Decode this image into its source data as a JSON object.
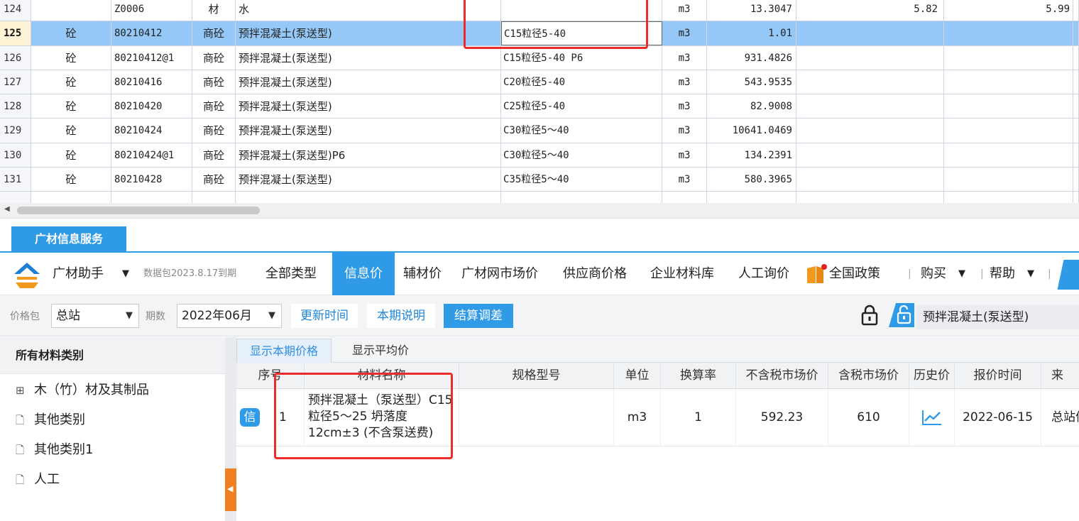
{
  "top_table": {
    "rows": [
      {
        "no": "124",
        "type": "",
        "code": "Z0006",
        "cat": "材",
        "name": "水",
        "spec": "",
        "unit": "m3",
        "qty": "13.3047",
        "price1": "5.82",
        "price2": "5.99",
        "selected": false
      },
      {
        "no": "125",
        "type": "砼",
        "code": "80210412",
        "cat": "商砼",
        "name": "预拌混凝土(泵送型)",
        "spec": "C15粒径5-40",
        "unit": "m3",
        "qty": "1.01",
        "price1": "",
        "price2": "",
        "selected": true
      },
      {
        "no": "126",
        "type": "砼",
        "code": "80210412@1",
        "cat": "商砼",
        "name": "预拌混凝土(泵送型)",
        "spec": "C15粒径5-40 P6",
        "unit": "m3",
        "qty": "931.4826",
        "price1": "",
        "price2": "",
        "selected": false
      },
      {
        "no": "127",
        "type": "砼",
        "code": "80210416",
        "cat": "商砼",
        "name": "预拌混凝土(泵送型)",
        "spec": "C20粒径5-40",
        "unit": "m3",
        "qty": "543.9535",
        "price1": "",
        "price2": "",
        "selected": false
      },
      {
        "no": "128",
        "type": "砼",
        "code": "80210420",
        "cat": "商砼",
        "name": "预拌混凝土(泵送型)",
        "spec": "C25粒径5-40",
        "unit": "m3",
        "qty": "82.9008",
        "price1": "",
        "price2": "",
        "selected": false
      },
      {
        "no": "129",
        "type": "砼",
        "code": "80210424",
        "cat": "商砼",
        "name": "预拌混凝土(泵送型)",
        "spec": "C30粒径5～40",
        "unit": "m3",
        "qty": "10641.0469",
        "price1": "",
        "price2": "",
        "selected": false
      },
      {
        "no": "130",
        "type": "砼",
        "code": "80210424@1",
        "cat": "商砼",
        "name": "预拌混凝土(泵送型)P6",
        "spec": "C30粒径5～40",
        "unit": "m3",
        "qty": "134.2391",
        "price1": "",
        "price2": "",
        "selected": false
      },
      {
        "no": "131",
        "type": "砼",
        "code": "80210428",
        "cat": "商砼",
        "name": "预拌混凝土(泵送型)",
        "spec": "C35粒径5～40",
        "unit": "m3",
        "qty": "580.3965",
        "price1": "",
        "price2": "",
        "selected": false
      }
    ]
  },
  "panel": {
    "tab_label": "广材信息服务"
  },
  "toolbar": {
    "assistant_label": "广材助手",
    "caret": "▼",
    "data_package": "数据包2023.8.17到期",
    "nav": {
      "all_types": "全部类型",
      "info_price": "信息价",
      "aux_price": "辅材价",
      "market_price": "广材网市场价",
      "supplier_price": "供应商价格",
      "enterprise_lib": "企业材料库",
      "labor_inquiry": "人工询价",
      "national_policy": "全国政策"
    },
    "separator": "|",
    "buy": "购买",
    "help": "帮助",
    "accent_color": "#2f9ae6"
  },
  "filter": {
    "price_pkg_label": "价格包",
    "price_pkg_value": "总站",
    "period_label": "期数",
    "period_value": "2022年06月",
    "update_time": "更新时间",
    "period_note": "本期说明",
    "settle_adjust": "结算调差",
    "search_name": "预拌混凝土(泵送型)"
  },
  "left_panel": {
    "header": "所有材料类别",
    "items": [
      {
        "icon": "expand-plus-icon",
        "glyph": "⊞",
        "label": "木（竹）材及其制品"
      },
      {
        "icon": "document-icon",
        "glyph": "🗋",
        "label": "其他类别"
      },
      {
        "icon": "document-icon",
        "glyph": "🗋",
        "label": "其他类别1"
      },
      {
        "icon": "document-icon",
        "glyph": "🗋",
        "label": "人工"
      }
    ]
  },
  "results": {
    "tabs": [
      "显示本期价格",
      "显示平均价"
    ],
    "columns": [
      "序号",
      "材料名称",
      "规格型号",
      "单位",
      "换算率",
      "不含税市场价",
      "含税市场价",
      "历史价",
      "报价时间",
      "来"
    ],
    "row": {
      "badge": "信",
      "index": "1",
      "name": "预拌混凝土（泵送型）C15粒径5～25 坍落度12cm±3 (不含泵送费)",
      "spec": "",
      "unit": "m3",
      "rate": "1",
      "price_ex_tax": "592.23",
      "price_inc_tax": "610",
      "history_icon": "trend-chart-icon",
      "quote_date": "2022-06-15",
      "source": "总站信"
    }
  },
  "highlight_color": "#ee2b2b"
}
